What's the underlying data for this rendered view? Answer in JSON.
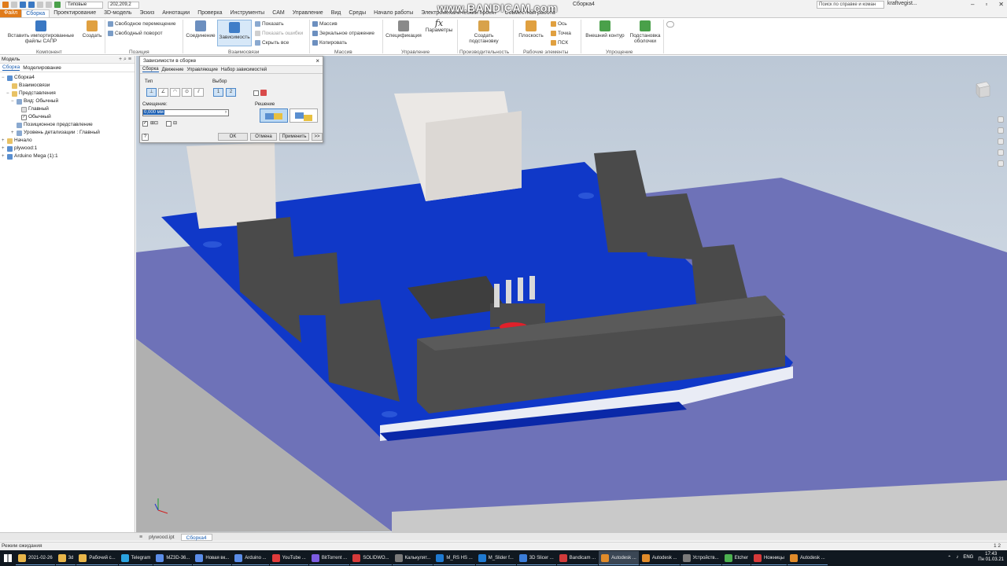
{
  "titlebar": {
    "preset": "Типовые",
    "coords": "202,209,2",
    "doc_title": "Сборка4",
    "search_placeholder": "Поиск по справке и коман",
    "user": "kraftvegist...",
    "watermark": "www.BANDICAM.com"
  },
  "tabs": [
    "Файл",
    "Сборка",
    "Проектирование",
    "3D-модель",
    "Эскиз",
    "Аннотации",
    "Проверка",
    "Инструменты",
    "CAM",
    "Управление",
    "Вид",
    "Среды",
    "Начало работы",
    "Электромеханический проект",
    "Совместная работа"
  ],
  "ribbon": {
    "insert": "Вставить импортированные файлы САПР",
    "create": "Создать",
    "free_move": "Свободное перемещение",
    "free_rotate": "Свободный поворот",
    "joint": "Соединение",
    "constrain": "Зависимость",
    "show": "Показать",
    "show_sick": "Показать ошибки",
    "hide_all": "Скрыть все",
    "pattern": "Массив",
    "mirror": "Зеркальное отражение",
    "copy": "Копировать",
    "bom": "Спецификация",
    "params": "Параметры",
    "substitute": "Создать подстановку",
    "plane": "Плоскость",
    "axis": "Ось",
    "point": "Точка",
    "ucs": "ПСК",
    "outer_contour": "Внешний контур",
    "shrinkwrap": "Подстановка оболочки",
    "groups": {
      "component": "Компонент",
      "position": "Позиция",
      "relationships": "Взаимосвязи",
      "pattern": "Массив",
      "manage": "Управление",
      "productivity": "Производительность",
      "work_features": "Рабочие элементы",
      "simplify": "Упрощение"
    }
  },
  "browser": {
    "header": "Модель",
    "tabs": [
      "Сборка",
      "Моделирование"
    ],
    "items": [
      {
        "label": "Сборка4",
        "level": 0,
        "exp": "−"
      },
      {
        "label": "Взаимосвязи",
        "level": 1,
        "exp": ""
      },
      {
        "label": "Представления",
        "level": 1,
        "exp": "−"
      },
      {
        "label": "Вид: Обычный",
        "level": 2,
        "exp": "−"
      },
      {
        "label": "Главный",
        "level": 3,
        "exp": ""
      },
      {
        "label": "Обычный",
        "level": 3,
        "exp": ""
      },
      {
        "label": "Позиционное представление",
        "level": 2,
        "exp": ""
      },
      {
        "label": "Уровень детализации : Главный",
        "level": 2,
        "exp": "+"
      },
      {
        "label": "Начало",
        "level": 1,
        "exp": "+"
      },
      {
        "label": "plywood:1",
        "level": 1,
        "exp": "+"
      },
      {
        "label": "Arduino Mega (1):1",
        "level": 1,
        "exp": "+"
      }
    ]
  },
  "dialog": {
    "title": "Зависимости в сборке",
    "tabs": [
      "Сборка",
      "Движение",
      "Управляющие",
      "Набор зависимостей"
    ],
    "type_label": "Тип",
    "selection_label": "Выбор",
    "offset_label": "Смещение:",
    "offset_value": "0,000 мм",
    "solution_label": "Решение",
    "ok": "OK",
    "cancel": "Отмена",
    "apply": "Применить",
    "more": ">>"
  },
  "doctabs": [
    "plywood.ipt",
    "Сборка4"
  ],
  "status": {
    "text": "Режим ожидания",
    "counts": "1    2"
  },
  "taskbar": {
    "items": [
      {
        "label": "2021-02-26",
        "color": "#e8b64a"
      },
      {
        "label": "3d",
        "color": "#e8b64a"
      },
      {
        "label": "Рабочий с...",
        "color": "#e8b64a"
      },
      {
        "label": "Telegram",
        "color": "#2aa3e0"
      },
      {
        "label": "MZ3D-36...",
        "color": "#5b8de8"
      },
      {
        "label": "Новая вк...",
        "color": "#5b8de8"
      },
      {
        "label": "Arduino ...",
        "color": "#5b8de8"
      },
      {
        "label": "YouTube ...",
        "color": "#e03b3b"
      },
      {
        "label": "BitTorrent ...",
        "color": "#7c5ce0"
      },
      {
        "label": "SOLIDWO...",
        "color": "#d63a3a"
      },
      {
        "label": "Калькулят...",
        "color": "#7a7a7a"
      },
      {
        "label": "M_RS HS ...",
        "color": "#1f7ad1"
      },
      {
        "label": "M_Slider f...",
        "color": "#1f7ad1"
      },
      {
        "label": "3D Slicer ...",
        "color": "#3b7dd8"
      },
      {
        "label": "Bandicam ...",
        "color": "#d13b3b"
      },
      {
        "label": "Autodesk ...",
        "color": "#e08b2a"
      },
      {
        "label": "Autodesk ...",
        "color": "#e08b2a"
      },
      {
        "label": "Устройств...",
        "color": "#7a7a7a"
      },
      {
        "label": "Etcher",
        "color": "#4cb050"
      },
      {
        "label": "Ножницы",
        "color": "#d63a3a"
      },
      {
        "label": "Autodesk ...",
        "color": "#e08b2a"
      }
    ],
    "lang": "ENG",
    "time": "17:43",
    "date": "Пн 01.03.21"
  }
}
